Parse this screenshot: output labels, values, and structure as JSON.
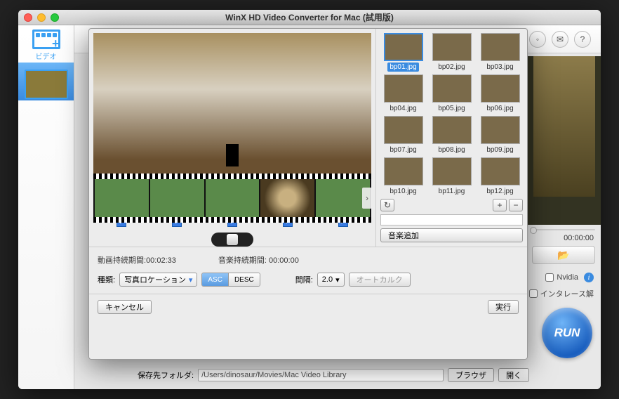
{
  "window": {
    "title": "WinX HD Video Converter for Mac (試用版)"
  },
  "sidebar": {
    "video_label": "ビデオ"
  },
  "topbar": {
    "icons": [
      "user-icon",
      "mail-icon",
      "help-icon"
    ]
  },
  "preview": {
    "timecode": "00:00:00",
    "folder_icon": "folder-open-icon"
  },
  "checks": {
    "nvidia": "Nvidia",
    "deinterlace": "インタレース解"
  },
  "run": {
    "label": "RUN"
  },
  "save": {
    "label": "保存先フォルダ:",
    "path": "/Users/dinosaur/Movies/Mac Video Library",
    "browse": "ブラウザ",
    "open": "開く"
  },
  "dialog": {
    "frames": [
      {
        "checked": true
      },
      {
        "checked": true
      },
      {
        "checked": true
      },
      {
        "checked": true,
        "swirl": true
      },
      {
        "checked": true
      }
    ],
    "thumbs": [
      {
        "label": "bp01.jpg",
        "selected": true
      },
      {
        "label": "bp02.jpg"
      },
      {
        "label": "bp03.jpg"
      },
      {
        "label": "bp04.jpg"
      },
      {
        "label": "bp05.jpg"
      },
      {
        "label": "bp06.jpg"
      },
      {
        "label": "bp07.jpg"
      },
      {
        "label": "bp08.jpg"
      },
      {
        "label": "bp09.jpg"
      },
      {
        "label": "bp10.jpg"
      },
      {
        "label": "bp11.jpg"
      },
      {
        "label": "bp12.jpg"
      }
    ],
    "grid_ctrls": {
      "rotate": "↻",
      "plus": "+",
      "minus": "−"
    },
    "add_music": "音楽追加",
    "video_duration_label": "動画持続期間:",
    "video_duration_value": "00:02:33",
    "audio_duration_label": "音楽持続期間:",
    "audio_duration_value": "00:00:00",
    "kind_label": "種類:",
    "kind_value": "写真ロケーション",
    "sort": {
      "asc": "ASC",
      "desc": "DESC"
    },
    "interval_label": "間隔:",
    "interval_value": "2.0",
    "autocalc": "オートカルク",
    "cancel": "キャンセル",
    "execute": "実行"
  }
}
